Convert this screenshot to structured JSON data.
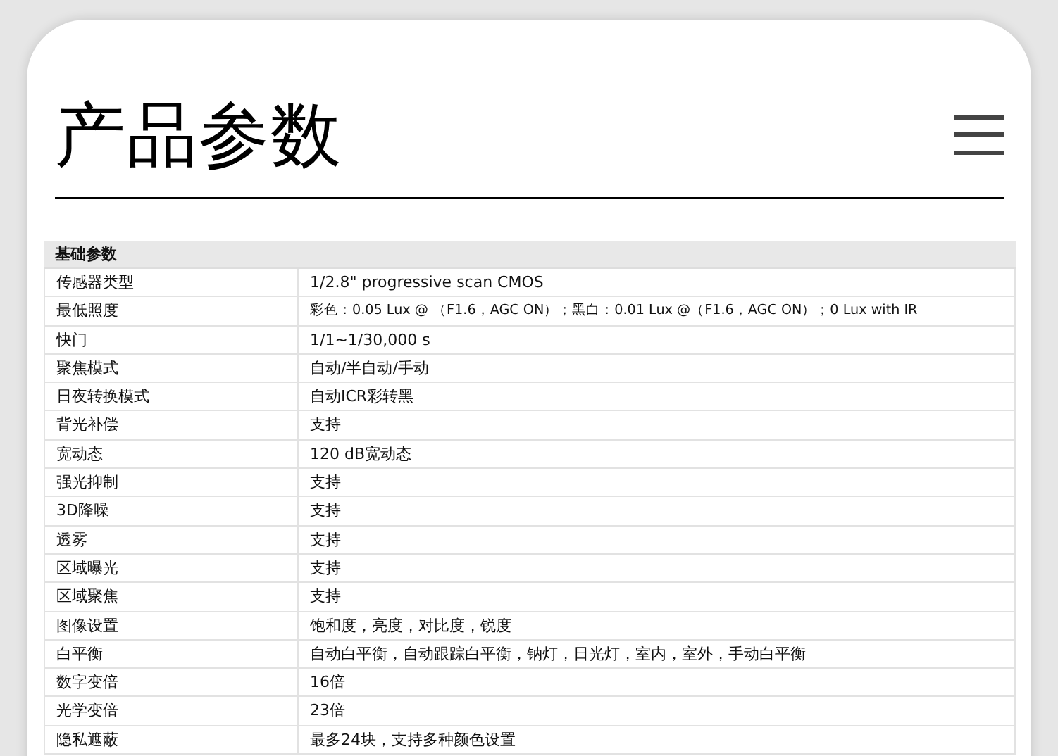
{
  "page": {
    "title": "产品参数"
  },
  "table": {
    "section": "基础参数",
    "rows": [
      [
        "传感器类型",
        "1/2.8\" progressive scan CMOS"
      ],
      [
        "最低照度",
        "彩色：0.05 Lux @ （F1.6，AGC ON）；黑白：0.01 Lux @（F1.6，AGC ON）；0 Lux with IR"
      ],
      [
        "快门",
        "1/1~1/30,000 s"
      ],
      [
        "聚焦模式",
        "自动/半自动/手动"
      ],
      [
        "日夜转换模式",
        "自动ICR彩转黑"
      ],
      [
        "背光补偿",
        "支持"
      ],
      [
        "宽动态",
        "120 dB宽动态"
      ],
      [
        "强光抑制",
        "支持"
      ],
      [
        "3D降噪",
        "支持"
      ],
      [
        "透雾",
        "支持"
      ],
      [
        "区域曝光",
        "支持"
      ],
      [
        "区域聚焦",
        "支持"
      ],
      [
        "图像设置",
        "饱和度，亮度，对比度，锐度"
      ],
      [
        "白平衡",
        "自动白平衡，自动跟踪白平衡，钠灯，日光灯，室内，室外，手动白平衡"
      ],
      [
        "数字变倍",
        "16倍"
      ],
      [
        "光学变倍",
        "23倍"
      ],
      [
        "隐私遮蔽",
        "最多24块，支持多种颜色设置"
      ]
    ]
  }
}
